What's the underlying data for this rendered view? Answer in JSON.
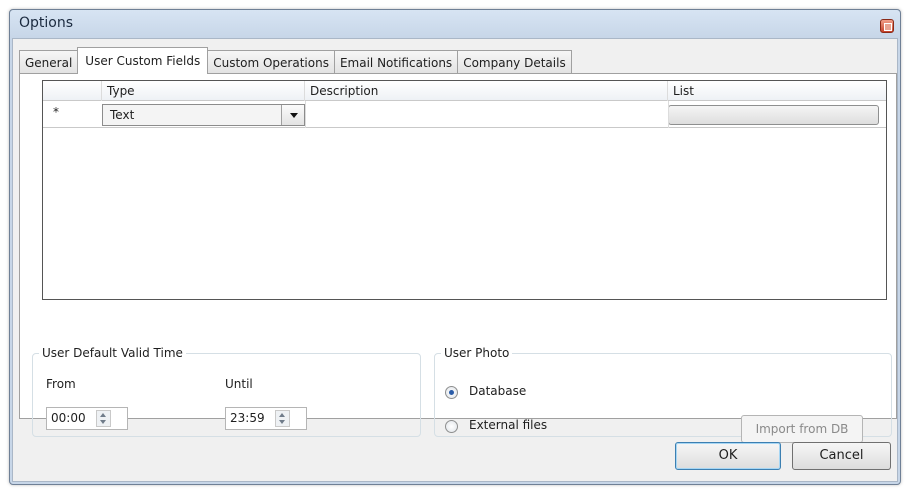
{
  "window": {
    "title": "Options"
  },
  "tabs": [
    {
      "label": "General"
    },
    {
      "label": "User Custom Fields",
      "active": true
    },
    {
      "label": "Custom Operations"
    },
    {
      "label": "Email Notifications"
    },
    {
      "label": "Company Details"
    }
  ],
  "grid": {
    "columns": [
      "Type",
      "Description",
      "List"
    ],
    "new_row": {
      "marker": "*",
      "type": "Text",
      "description": "",
      "list": ""
    }
  },
  "valid_time": {
    "title": "User Default Valid Time",
    "from_label": "From",
    "from_value": "00:00",
    "until_label": "Until",
    "until_value": "23:59"
  },
  "photo": {
    "title": "User Photo",
    "options": [
      {
        "label": "Database",
        "checked": true
      },
      {
        "label": "External files",
        "checked": false
      }
    ],
    "import_label": "Import from DB"
  },
  "buttons": {
    "ok": "OK",
    "cancel": "Cancel"
  },
  "colors": {
    "accent": "#2a5ca8",
    "frame": "#c7d6e8"
  }
}
